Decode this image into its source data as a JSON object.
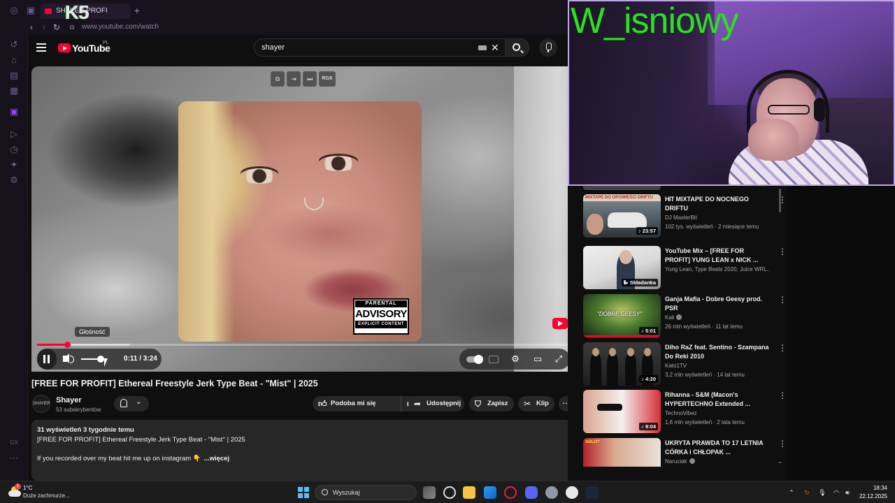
{
  "browser": {
    "tab_title": "SHAYER PROFI",
    "stream_logo": "K5",
    "url": "www.youtube.com/watch"
  },
  "youtube": {
    "logo_text": "YouTube",
    "region": "PL",
    "search_query": "shayer",
    "player": {
      "toolbar": [
        "⧉",
        "⇥",
        "⏭",
        "RGX"
      ],
      "volume_tooltip": "Głośność",
      "time": "0:11 / 3:24",
      "progress_fraction": 0.056,
      "buffer_fraction": 0.174,
      "advisory": {
        "top": "PARENTAL",
        "middle": "ADVISORY",
        "bottom": "EXPLICIT CONTENT"
      }
    },
    "video": {
      "title": "[FREE FOR PROFIT] Ethereal Freestyle Jerk Type Beat - \"Mist\" | 2025",
      "channel": "Shayer",
      "avatar_text": "SHAYER",
      "subscribers": "53 subskrybentów",
      "actions": {
        "like": "Podoba mi się",
        "share": "Udostępnij",
        "save": "Zapisz",
        "clip": "Klip"
      }
    },
    "description": {
      "stats": "31 wyświetleń  3 tygodnie temu",
      "line1": "[FREE FOR PROFIT] Ethereal Freestyle Jerk Type Beat - \"Mist\" | 2025",
      "line2": "If you recorded over my beat hit me up on instagram 👇",
      "more": "...więcej"
    }
  },
  "recommendations": [
    {
      "title": "MIXTAPE DO NOCNEGO DRIFTU",
      "brand": "HIT",
      "thumb_top": "MIXTAPE DO OPOWIEŚCI DRIFTU",
      "channel": "DJ MasterBit",
      "meta": "102 tys. wyświetleń · 2 miesiące temu",
      "badge": "♪ 23:57"
    },
    {
      "title": "YouTube Mix – [FREE FOR PROFIT] YUNG LEAN x NICK ...",
      "channel": "Yung Lean, Type Beats 2020, Juice WRL...",
      "meta": "",
      "badge": "⦀▸ Składanka"
    },
    {
      "title": "Ganja Mafia - Dobre Geesy prod. PSR",
      "channel": "Kali",
      "meta": "26 mln wyświetleń · 11 lat temu",
      "badge": "♪ 5:01",
      "thumb_text": "\"DOBRE GEESY\""
    },
    {
      "title": "Diho RaZ feat. Sentino - Szampana Do Reki 2010",
      "channel": "Kato1TV",
      "meta": "3,2 mln wyświetleń · 14 lat temu",
      "badge": "♪ 4:20"
    },
    {
      "title": "Rihanna - S&M (Macon's HYPERTECHNO Extended ...",
      "channel": "TechnoVibez",
      "meta": "1,6 mln wyświetleń · 2 lata temu",
      "badge": "♪ 9:04"
    },
    {
      "title": "UKRYTA PRAWDA TO 17 LETNIA CÓRKA i CHŁOPAK ...",
      "channel": "Naruciak",
      "meta": "",
      "badge": "",
      "thumb_text": "SOLO?"
    }
  ],
  "webcam": {
    "nickname": "W_isniowy"
  },
  "taskbar": {
    "temperature": "1°C",
    "weather": "Duże zachmurze...",
    "weather_badge": "1",
    "search_placeholder": "Wyszukaj",
    "time": "18:34",
    "date": "22.12.2025"
  },
  "colors": {
    "youtube_red": "#ff0033",
    "nickname_green": "#29e21f",
    "accent_blue": "#4cc2ff"
  }
}
